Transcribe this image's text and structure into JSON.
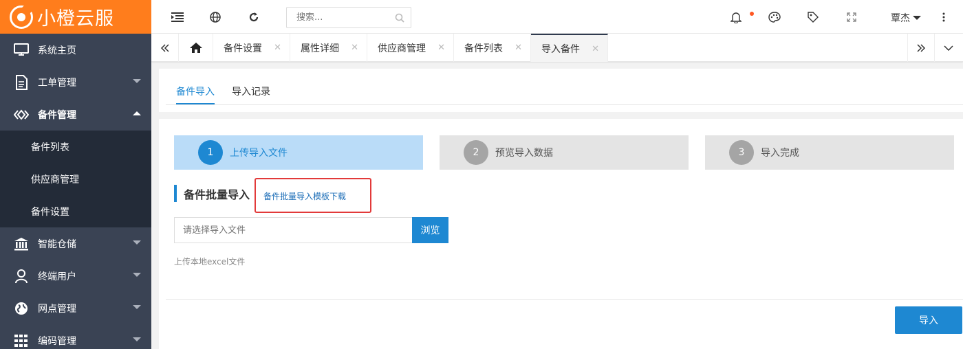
{
  "app": {
    "logo_text": "小橙云服",
    "brand_color": "#ff7d1c",
    "accent_color": "#1e88d2"
  },
  "sidebar": {
    "items": [
      {
        "label": "系统主页",
        "icon": "monitor-icon"
      },
      {
        "label": "工单管理",
        "icon": "document-icon"
      },
      {
        "label": "备件管理",
        "icon": "diamond-icon",
        "expanded": true
      },
      {
        "label": "智能仓储",
        "icon": "bank-icon"
      },
      {
        "label": "终端用户",
        "icon": "user-icon"
      },
      {
        "label": "网点管理",
        "icon": "globe-icon"
      },
      {
        "label": "编码管理",
        "icon": "grid-icon"
      }
    ],
    "sub_items": [
      "备件列表",
      "供应商管理",
      "备件设置"
    ]
  },
  "header": {
    "search_placeholder": "搜索...",
    "user_name": "覃杰",
    "icons": [
      "menu-fold-icon",
      "globe-icon",
      "refresh-icon",
      "search-icon",
      "bell-icon",
      "palette-icon",
      "tag-icon",
      "fullscreen-icon",
      "more-icon"
    ]
  },
  "tabs": {
    "items": [
      "备件设置",
      "属性详细",
      "供应商管理",
      "备件列表",
      "导入备件"
    ],
    "active": "导入备件"
  },
  "content_tabs": {
    "items": [
      "备件导入",
      "导入记录"
    ],
    "active": "备件导入"
  },
  "steps": [
    {
      "num": "1",
      "label": "上传导入文件",
      "active": true
    },
    {
      "num": "2",
      "label": "预览导入数据",
      "active": false
    },
    {
      "num": "3",
      "label": "导入完成",
      "active": false
    }
  ],
  "section": {
    "title": "备件批量导入",
    "template_link": "备件批量导入模板下载",
    "file_placeholder": "请选择导入文件",
    "browse_label": "浏览",
    "hint": "上传本地excel文件",
    "import_label": "导入"
  }
}
